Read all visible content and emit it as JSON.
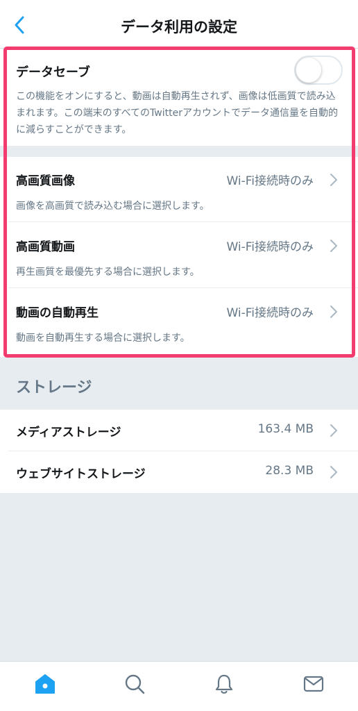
{
  "header": {
    "title": "データ利用の設定"
  },
  "data_saver": {
    "label": "データセーブ",
    "enabled": false,
    "description": "この機能をオンにすると、動画は自動再生されず、画像は低画質で読み込まれます。この端末のすべてのTwitterアカウントでデータ通信量を自動的に減らすことができます。"
  },
  "settings": [
    {
      "label": "高画質画像",
      "value": "Wi-Fi接続時のみ",
      "description": "画像を高画質で読み込む場合に選択します。"
    },
    {
      "label": "高画質動画",
      "value": "Wi-Fi接続時のみ",
      "description": "再生画質を最優先する場合に選択します。"
    },
    {
      "label": "動画の自動再生",
      "value": "Wi-Fi接続時のみ",
      "description": "動画を自動再生する場合に選択します。"
    }
  ],
  "storage": {
    "heading": "ストレージ",
    "items": [
      {
        "label": "メディアストレージ",
        "value": "163.4 MB"
      },
      {
        "label": "ウェブサイトストレージ",
        "value": "28.3 MB"
      }
    ]
  },
  "tabbar": {
    "tabs": [
      {
        "icon": "home-icon",
        "active": true
      },
      {
        "icon": "search-icon",
        "active": false
      },
      {
        "icon": "bell-icon",
        "active": false
      },
      {
        "icon": "mail-icon",
        "active": false
      }
    ]
  },
  "colors": {
    "accent": "#1da1f2",
    "highlight": "#f23b6f",
    "secondary_text": "#657786",
    "background": "#e6ecf0"
  }
}
